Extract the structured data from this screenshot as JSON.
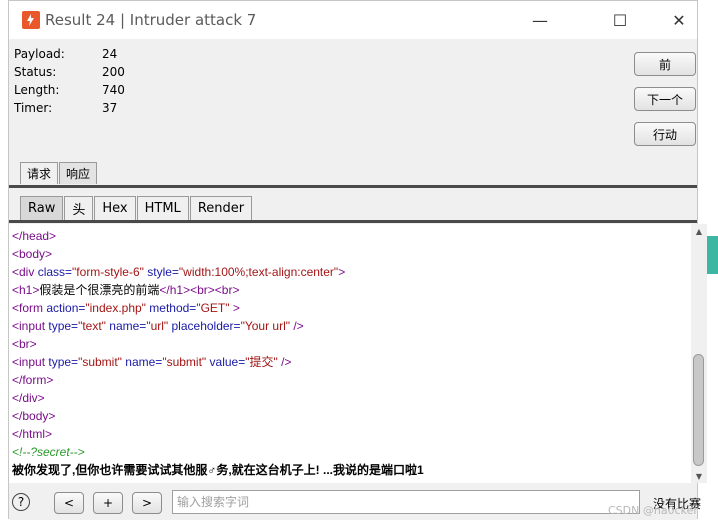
{
  "window": {
    "title": "Result 24 | Intruder attack 7",
    "minimize": "—",
    "maximize": "☐",
    "close": "✕"
  },
  "info": {
    "payload_label": "Payload:",
    "payload": "24",
    "status_label": "Status:",
    "status": "200",
    "length_label": "Length:",
    "length": "740",
    "timer_label": "Timer:",
    "timer": "37"
  },
  "side_buttons": {
    "prev": "前",
    "next": "下一个",
    "action": "行动"
  },
  "tabs": {
    "request": "请求",
    "response": "响应"
  },
  "view_tabs": {
    "raw": "Raw",
    "headers": "头",
    "hex": "Hex",
    "html": "HTML",
    "render": "Render"
  },
  "code": {
    "l1": "</head>",
    "l2": "<body>",
    "l3_tag": "<div ",
    "l3_a1": "class=",
    "l3_v1": "\"form-style-6\"",
    "l3_a2": " style=",
    "l3_v2": "\"width:100%;text-align:center\"",
    "l3_end": ">",
    "l4_open": "<h1>",
    "l4_text": "假装是个很漂亮的前端",
    "l4_close": "</h1><br><br>",
    "l5_tag": "<form ",
    "l5_a1": "action=",
    "l5_v1": "\"index.php\"",
    "l5_a2": " method=",
    "l5_v2": "\"GET\"",
    "l5_end": " >",
    "l6_tag": "<input ",
    "l6_a1": "type=",
    "l6_v1": "\"text\"",
    "l6_a2": " name=",
    "l6_v2": "\"url\"",
    "l6_a3": " placeholder=",
    "l6_v3": "\"Your url\"",
    "l6_end": " />",
    "l7": "<br>",
    "l8_tag": "<input ",
    "l8_a1": "type=",
    "l8_v1": "\"submit\"",
    "l8_a2": " name=",
    "l8_v2": "\"submit\"",
    "l8_a3": " value=",
    "l8_v3": "\"提交\"",
    "l8_end": " />",
    "l9": "</form>",
    "l10": "</div>",
    "l11": "</body>",
    "l12": "</html>",
    "l13": "<!--?secret-->",
    "l14": "被你发现了,但你也许需要试试其他服♂务,就在这台机子上! ...我说的是端口啦1"
  },
  "bottom": {
    "help": "?",
    "prev": "<",
    "add": "+",
    "next": ">",
    "search_placeholder": "输入搜索字词",
    "search_value": "",
    "match_status": "没有比赛"
  },
  "watermark": "CSDN @ha0cker",
  "colors": {
    "accent_orange": "#e8582a",
    "teal": "#3cb8a2"
  }
}
